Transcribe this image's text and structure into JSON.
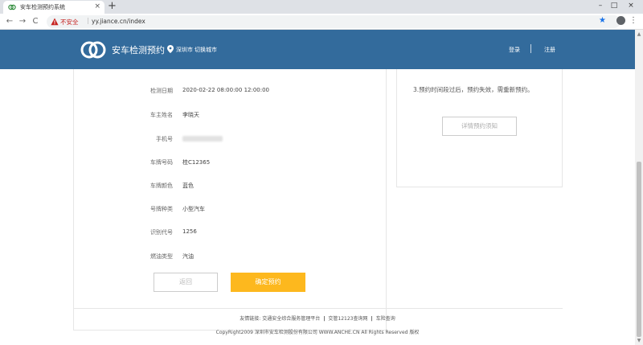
{
  "browser": {
    "tab_title": "安车检测预约系统",
    "tab_close": "×",
    "new_tab": "+",
    "security_label": "不安全",
    "url": "yy.jiance.cn/index",
    "nav": {
      "back": "←",
      "forward": "→",
      "reload": "C"
    },
    "window": {
      "minimize": "–",
      "maximize": "□",
      "close": "×"
    },
    "star": "★",
    "menu": "⋮"
  },
  "header": {
    "brand": "安车检测预约",
    "city": "深圳市",
    "switch_city": "切换城市",
    "login": "登录",
    "register": "注册"
  },
  "form": {
    "rows": [
      {
        "label": "检测日期",
        "value": "2020-02-22 08:00:00 12:00:00"
      },
      {
        "label": "车主姓名",
        "value": "李晓天"
      },
      {
        "label": "手机号",
        "value": ""
      },
      {
        "label": "车牌号码",
        "value": "桂C12365"
      },
      {
        "label": "车牌颜色",
        "value": "蓝色"
      },
      {
        "label": "号牌种类",
        "value": "小型汽车"
      },
      {
        "label": "识别代号",
        "value": "1256"
      },
      {
        "label": "燃油类型",
        "value": "汽油"
      }
    ],
    "back_label": "返回",
    "confirm_label": "确定预约"
  },
  "notice": {
    "text": "3.预约时间段过后，预约失效，需重新预约。",
    "details_label": "详情预约须知"
  },
  "footer": {
    "links": [
      "友情链接: 交通安全综合服务管理平台",
      "交管12123查询网",
      "车险查询"
    ],
    "link_sep": "|",
    "copyright": "CopyRight2009 深圳市安车检测股份有限公司 WWW.ANCHE.CN All Rights Reserved 版权"
  },
  "scrollbar": {
    "up": "▲",
    "down": "▼"
  },
  "colors": {
    "header": "#336b9c",
    "accent": "#fdb81e",
    "warning": "#c5221f"
  }
}
